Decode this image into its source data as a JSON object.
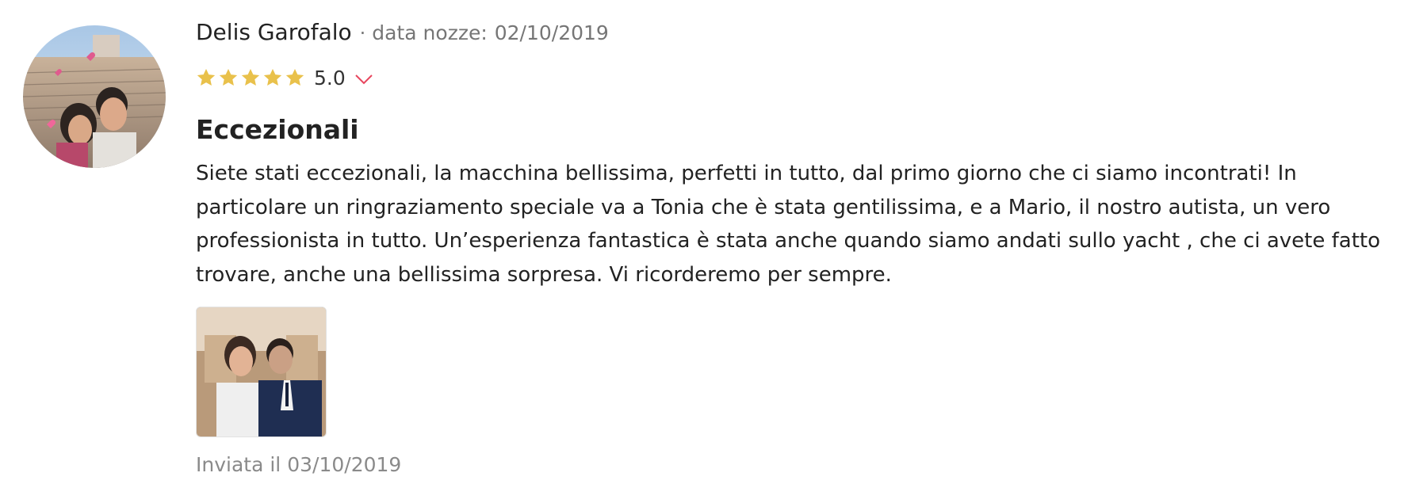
{
  "review": {
    "author": "Delis Garofalo",
    "separator": "·",
    "wedding_date_label": "data nozze:",
    "wedding_date": "02/10/2019",
    "rating": 5,
    "rating_display": "5.0",
    "title": "Eccezionali",
    "body": "Siete stati eccezionali, la macchina bellissima, perfetti in tutto, dal primo giorno che ci siamo incontrati! In particolare un ringraziamento speciale va a Tonia che è stata gentilissima, e a Mario, il nostro autista, un vero professionista in tutto. Un’esperienza fantastica è stata anche quando siamo andati sullo yacht , che ci avete fatto trovare, anche una bellissima sorpresa. Vi ricorderemo per sempre.",
    "sent_label": "Inviata il",
    "sent_date": "03/10/2019"
  },
  "icons": {
    "star": "star-icon",
    "chevron": "chevron-down-icon"
  },
  "colors": {
    "star": "#E9C14B",
    "chevron": "#E8465E",
    "muted_text": "#767676"
  }
}
